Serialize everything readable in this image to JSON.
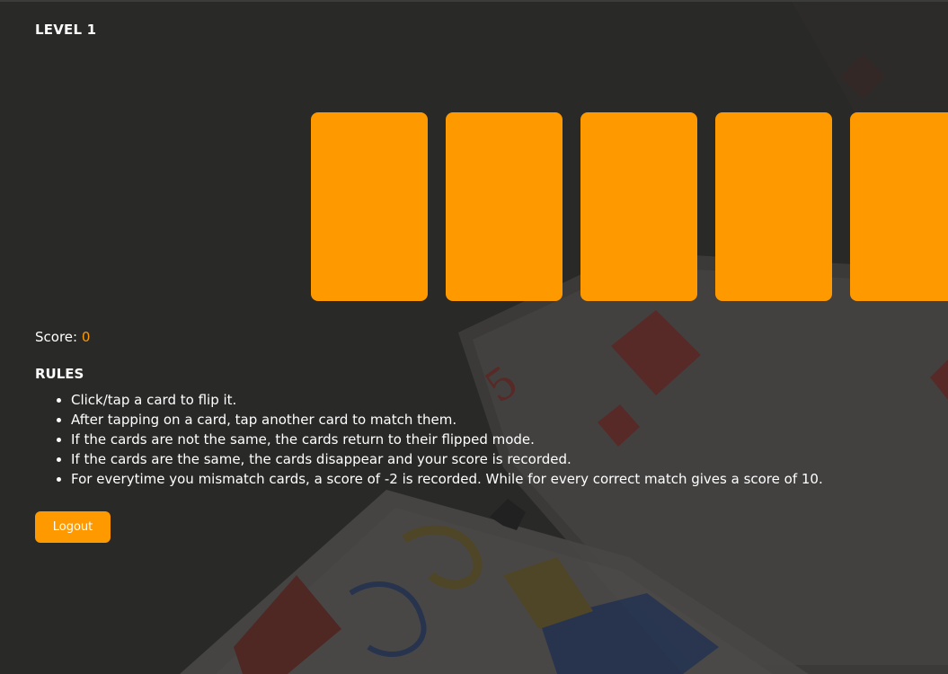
{
  "level": {
    "title": "LEVEL 1"
  },
  "cards": [
    {
      "face": "back"
    },
    {
      "face": "back"
    },
    {
      "face": "back"
    },
    {
      "face": "back"
    },
    {
      "face": "back"
    }
  ],
  "score": {
    "label": "Score: ",
    "value": "0"
  },
  "rules": {
    "title": "RULES",
    "items": [
      "Click/tap a card to flip it.",
      "After tapping on a card, tap another card to match them.",
      "If the cards are not the same, the cards return to their flipped mode.",
      "If the cards are the same, the cards disappear and your score is recorded.",
      "For everytime you mismatch cards, a score of -2 is recorded. While for every correct match gives a score of 10."
    ]
  },
  "logout": {
    "label": "Logout"
  },
  "colors": {
    "accent": "#ff9900",
    "background": "#2b2b29"
  }
}
